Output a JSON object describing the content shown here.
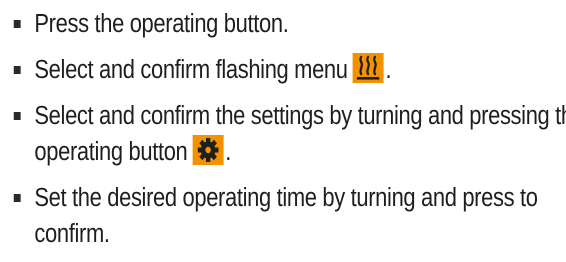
{
  "steps": [
    {
      "text": "Press the operating button."
    },
    {
      "text": "Select and confirm flashing menu",
      "icon": "heating-icon",
      "suffix": "."
    },
    {
      "text": "Select and confirm the settings by turning and pressing the operating button",
      "icon": "gear-icon",
      "suffix": "."
    },
    {
      "text": "Set the desired operating time by turning and press to confirm."
    }
  ],
  "colors": {
    "icon_background": "#f39200",
    "icon_glyph": "#1e1e1e",
    "text": "#1e1e1e"
  }
}
